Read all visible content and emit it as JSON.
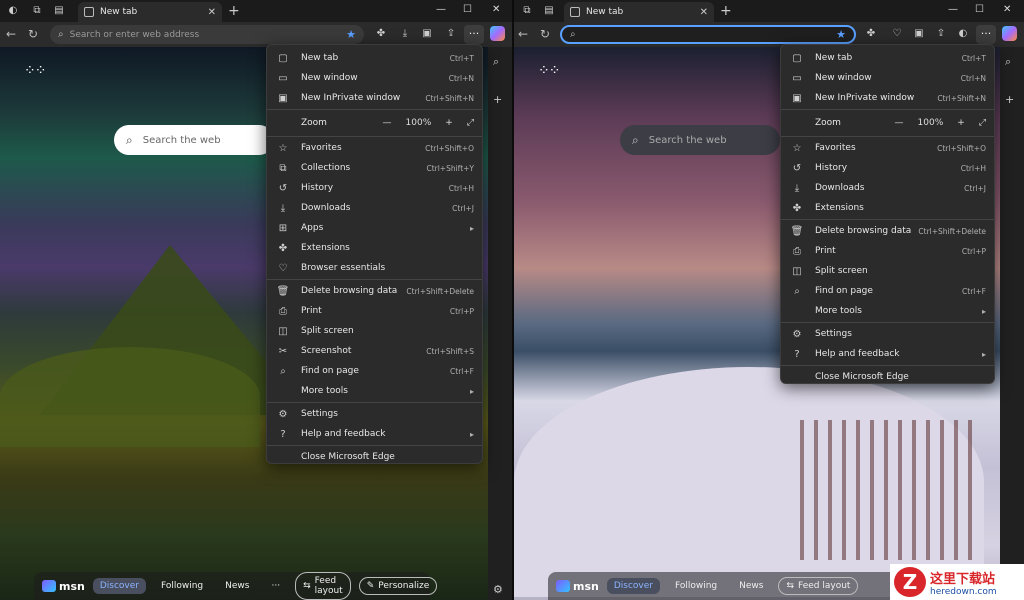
{
  "left": {
    "tab_title": "New tab",
    "address_placeholder": "Search or enter web address",
    "search_placeholder": "Search the web",
    "menu": {
      "items": [
        {
          "icon": "new-tab-icon",
          "glyph": "▢",
          "label": "New tab",
          "shortcut": "Ctrl+T"
        },
        {
          "icon": "new-window-icon",
          "glyph": "▭",
          "label": "New window",
          "shortcut": "Ctrl+N"
        },
        {
          "icon": "inprivate-icon",
          "glyph": "▣",
          "label": "New InPrivate window",
          "shortcut": "Ctrl+Shift+N"
        }
      ],
      "zoom": {
        "label": "Zoom",
        "value": "100%"
      },
      "items2": [
        {
          "icon": "favorites-icon",
          "glyph": "☆",
          "label": "Favorites",
          "shortcut": "Ctrl+Shift+O"
        },
        {
          "icon": "collections-icon",
          "glyph": "⧉",
          "label": "Collections",
          "shortcut": "Ctrl+Shift+Y"
        },
        {
          "icon": "history-icon",
          "glyph": "↺",
          "label": "History",
          "shortcut": "Ctrl+H"
        },
        {
          "icon": "downloads-icon",
          "glyph": "⤓",
          "label": "Downloads",
          "shortcut": "Ctrl+J"
        },
        {
          "icon": "apps-icon",
          "glyph": "⊞",
          "label": "Apps",
          "shortcut": "",
          "submenu": true
        },
        {
          "icon": "extensions-icon",
          "glyph": "✤",
          "label": "Extensions",
          "shortcut": ""
        },
        {
          "icon": "browser-essentials-icon",
          "glyph": "♡",
          "label": "Browser essentials",
          "shortcut": ""
        }
      ],
      "items3": [
        {
          "icon": "delete-icon",
          "glyph": "🗑",
          "label": "Delete browsing data",
          "shortcut": "Ctrl+Shift+Delete"
        },
        {
          "icon": "print-icon",
          "glyph": "⎙",
          "label": "Print",
          "shortcut": "Ctrl+P"
        },
        {
          "icon": "split-screen-icon",
          "glyph": "◫",
          "label": "Split screen",
          "shortcut": ""
        },
        {
          "icon": "screenshot-icon",
          "glyph": "✂",
          "label": "Screenshot",
          "shortcut": "Ctrl+Shift+S"
        },
        {
          "icon": "find-icon",
          "glyph": "⌕",
          "label": "Find on page",
          "shortcut": "Ctrl+F"
        },
        {
          "icon": "more-tools-icon",
          "glyph": "",
          "label": "More tools",
          "shortcut": "",
          "submenu": true
        }
      ],
      "items4": [
        {
          "icon": "settings-icon",
          "glyph": "⚙",
          "label": "Settings",
          "shortcut": ""
        },
        {
          "icon": "help-icon",
          "glyph": "?",
          "label": "Help and feedback",
          "shortcut": "",
          "submenu": true
        }
      ],
      "close": "Close Microsoft Edge"
    },
    "feed": {
      "brand": "msn",
      "discover": "Discover",
      "following": "Following",
      "news": "News",
      "more": "···",
      "feed_layout": "Feed layout",
      "personalize": "Personalize"
    }
  },
  "right": {
    "tab_title": "New tab",
    "search_placeholder": "Search the web",
    "menu": {
      "items": [
        {
          "icon": "new-tab-icon",
          "glyph": "▢",
          "label": "New tab",
          "shortcut": "Ctrl+T"
        },
        {
          "icon": "new-window-icon",
          "glyph": "▭",
          "label": "New window",
          "shortcut": "Ctrl+N"
        },
        {
          "icon": "inprivate-icon",
          "glyph": "▣",
          "label": "New InPrivate window",
          "shortcut": "Ctrl+Shift+N"
        }
      ],
      "zoom": {
        "label": "Zoom",
        "value": "100%"
      },
      "items2": [
        {
          "icon": "favorites-icon",
          "glyph": "☆",
          "label": "Favorites",
          "shortcut": "Ctrl+Shift+O"
        },
        {
          "icon": "history-icon",
          "glyph": "↺",
          "label": "History",
          "shortcut": "Ctrl+H"
        },
        {
          "icon": "downloads-icon",
          "glyph": "⤓",
          "label": "Downloads",
          "shortcut": "Ctrl+J"
        },
        {
          "icon": "extensions-icon",
          "glyph": "✤",
          "label": "Extensions",
          "shortcut": ""
        }
      ],
      "items3": [
        {
          "icon": "delete-icon",
          "glyph": "🗑",
          "label": "Delete browsing data",
          "shortcut": "Ctrl+Shift+Delete"
        },
        {
          "icon": "print-icon",
          "glyph": "⎙",
          "label": "Print",
          "shortcut": "Ctrl+P"
        },
        {
          "icon": "split-screen-icon",
          "glyph": "◫",
          "label": "Split screen",
          "shortcut": ""
        },
        {
          "icon": "find-icon",
          "glyph": "⌕",
          "label": "Find on page",
          "shortcut": "Ctrl+F"
        },
        {
          "icon": "more-tools-icon",
          "glyph": "",
          "label": "More tools",
          "shortcut": "",
          "submenu": true
        }
      ],
      "items4": [
        {
          "icon": "settings-icon",
          "glyph": "⚙",
          "label": "Settings",
          "shortcut": ""
        },
        {
          "icon": "help-icon",
          "glyph": "?",
          "label": "Help and feedback",
          "shortcut": "",
          "submenu": true
        }
      ],
      "close": "Close Microsoft Edge"
    },
    "feed": {
      "brand": "msn",
      "discover": "Discover",
      "following": "Following",
      "news": "News",
      "feed_layout": "Feed layout"
    }
  },
  "watermark": {
    "cn": "这里下载站",
    "en": "heredown.com",
    "logo": "Z"
  },
  "colors": {
    "accent": "#5aa0ff",
    "menu_bg": "#2b2b2b",
    "toolbar_bg": "#2b2b2b"
  }
}
